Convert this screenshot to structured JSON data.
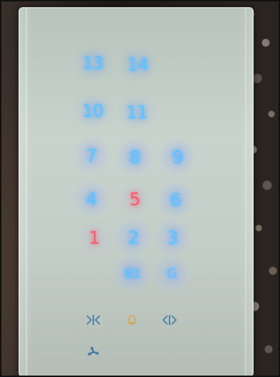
{
  "elevator_panel": {
    "buttons": [
      {
        "label": "13",
        "lit": false
      },
      {
        "label": "14",
        "lit": false
      },
      {
        "label": "10",
        "lit": false
      },
      {
        "label": "11",
        "lit": false
      },
      {
        "label": "7",
        "lit": false
      },
      {
        "label": "8",
        "lit": false
      },
      {
        "label": "9",
        "lit": false
      },
      {
        "label": "4",
        "lit": false
      },
      {
        "label": "5",
        "lit": true
      },
      {
        "label": "6",
        "lit": false
      },
      {
        "label": "1",
        "lit": true
      },
      {
        "label": "2",
        "lit": false
      },
      {
        "label": "3",
        "lit": false
      },
      {
        "label": "B1",
        "lit": false
      },
      {
        "label": "G",
        "lit": false
      }
    ],
    "controls": {
      "close_door": "door-close-icon",
      "alarm": "alarm-bell-icon",
      "open_door": "door-open-icon",
      "fan": "fan-icon"
    },
    "colors": {
      "floor_button": "#5fc3ff",
      "selected_floor": "#ff5a6e",
      "alarm_icon": "#d6a34a",
      "door_icons": "#4a7fa8"
    }
  }
}
